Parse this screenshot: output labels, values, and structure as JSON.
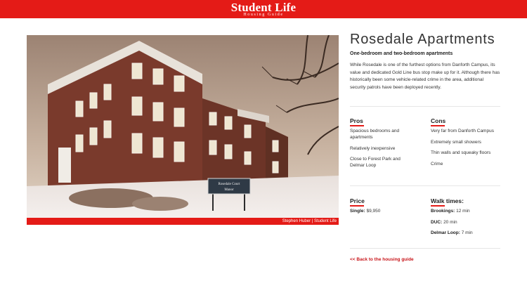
{
  "header": {
    "logo_title": "Student Life",
    "logo_subtitle": "Housing Guide",
    "brand_color": "#e41b17"
  },
  "photo": {
    "credit": "Stephen Huber | Student Life",
    "sign_line1": "Rosedale Court",
    "sign_line2": "Manor"
  },
  "listing": {
    "title": "Rosedale Apartments",
    "subtitle": "One-bedroom and two-bedroom apartments",
    "description": "While Rosedale is one of the furthest options from Danforth Campus, its value and dedicated Gold Line bus stop make up for it. Although there has historically been some vehicle-related crime in the area, additional security patrols have been deployed recently.",
    "pros_label": "Pros",
    "pros": [
      "Spacious bedrooms and apartments",
      "Relatively inexpensive",
      "Close to Forest Park and Delmar Loop"
    ],
    "cons_label": "Cons",
    "cons": [
      "Very far from Danforth Campus",
      "Extremely small showers",
      "Thin walls and squeaky floors",
      "Crime"
    ],
    "price_label": "Price",
    "price": {
      "key": "Single:",
      "value": "$9,950"
    },
    "walk_label": "Walk times:",
    "walk_times": [
      {
        "key": "Brookings:",
        "value": "12 min"
      },
      {
        "key": "DUC:",
        "value": "20 min"
      },
      {
        "key": "Delmar Loop:",
        "value": "7 min"
      }
    ]
  },
  "back_link": "<< Back to the housing guide"
}
